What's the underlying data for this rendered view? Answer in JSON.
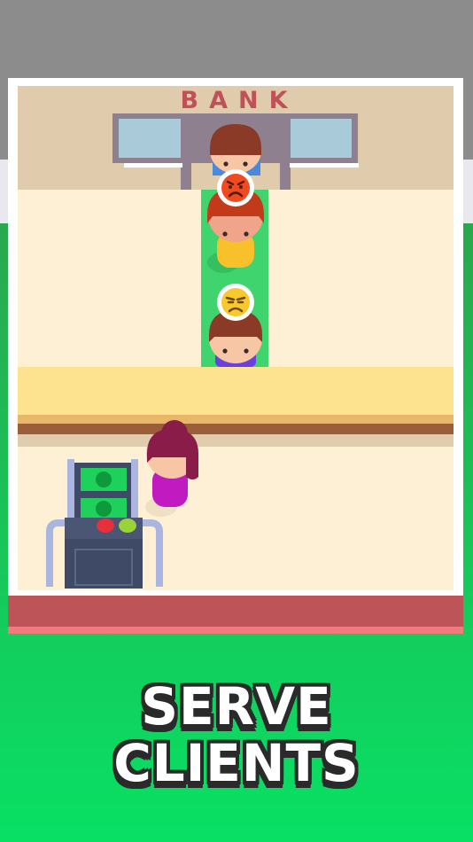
{
  "game": {
    "building_sign": "BANK",
    "caption": {
      "line1": "SERVE",
      "line2": "CLIENTS"
    }
  },
  "clients": [
    {
      "position": "at-counter",
      "mood": null
    },
    {
      "position": "queue-1",
      "mood": "angry",
      "mood_icon": "angry-face-icon"
    },
    {
      "position": "queue-2",
      "mood": "annoyed",
      "mood_icon": "annoyed-face-icon"
    }
  ],
  "colors": {
    "sky": "#8c8c8c",
    "ground_green": "#16cc5c",
    "floor": "#fdf0d5",
    "wall": "#e0ccac",
    "queue_lane": "#3fd46e",
    "sign_red": "#c0505a",
    "counter": "#fde290",
    "cashier_hair": "#8a1c4a",
    "cashier_shirt": "#c01ac0",
    "money_green": "#1dd15a",
    "button_red": "#e8303a",
    "button_green": "#9ad23a",
    "caption_outline": "#2a2a2a"
  }
}
